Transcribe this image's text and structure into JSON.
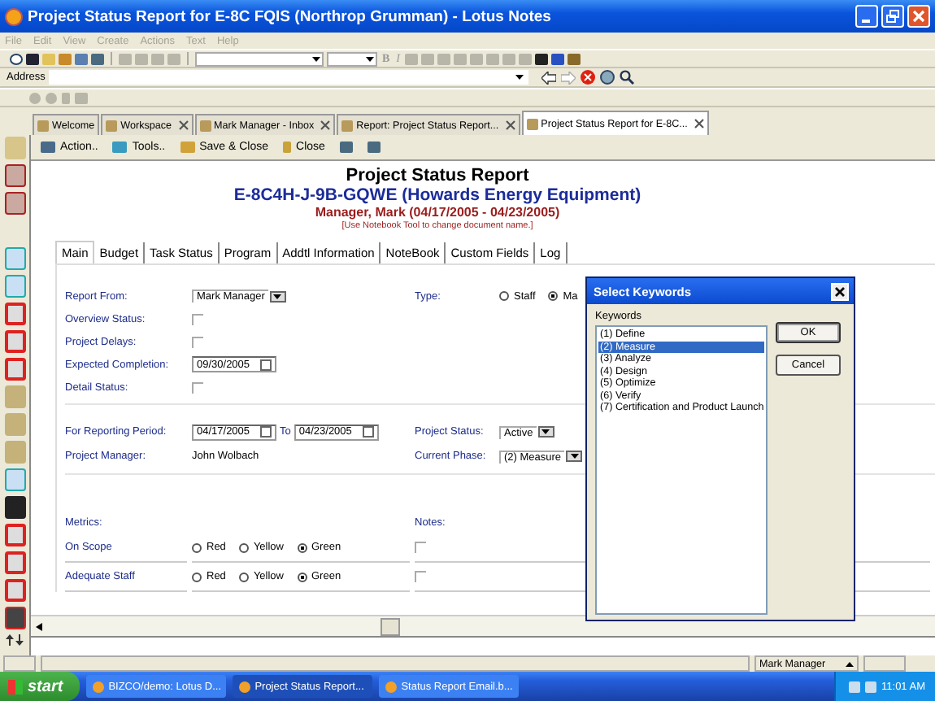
{
  "window": {
    "title": "Project Status Report for E-8C FQIS (Northrop Grumman) - Lotus Notes"
  },
  "menu": [
    {
      "label": "File",
      "disabled": true
    },
    {
      "label": "Edit",
      "disabled": true
    },
    {
      "label": "View",
      "disabled": true
    },
    {
      "label": "Create",
      "disabled": true
    },
    {
      "label": "Actions",
      "disabled": true
    },
    {
      "label": "Text",
      "disabled": true
    },
    {
      "label": "Help",
      "disabled": true
    }
  ],
  "toolbar": {
    "format_buttons": [
      "B",
      "I"
    ]
  },
  "address": {
    "label": "Address"
  },
  "tabs": [
    {
      "label": "Welcome",
      "selected": false,
      "closable": false
    },
    {
      "label": "Workspace",
      "selected": false,
      "closable": true
    },
    {
      "label": "Mark Manager - Inbox",
      "selected": false,
      "closable": true
    },
    {
      "label": "Report:  Project Status Report...",
      "selected": false,
      "closable": true
    },
    {
      "label": "Project Status Report for E-8C...",
      "selected": true,
      "closable": true
    }
  ],
  "actions": [
    "Action..",
    "Tools..",
    "Save & Close",
    "Close"
  ],
  "document": {
    "title": "Project Status Report",
    "subtitle": "E-8C4H-J-9B-GQWE (Howards Energy Equipment)",
    "manager_line": "Manager, Mark (04/17/2005 - 04/23/2005)",
    "hint": "[Use Notebook Tool to change document name.]",
    "tabs": [
      {
        "label": "Main",
        "selected": true
      },
      {
        "label": "Budget",
        "selected": false
      },
      {
        "label": "Task Status",
        "selected": false
      },
      {
        "label": "Program",
        "selected": false
      },
      {
        "label": "Addtl Information",
        "selected": false
      },
      {
        "label": "NoteBook",
        "selected": false
      },
      {
        "label": "Custom Fields",
        "selected": false
      },
      {
        "label": "Log",
        "selected": false
      }
    ]
  },
  "form": {
    "fields": [
      {
        "label": "Report From:",
        "kind": "keyword",
        "value": "Mark Manager"
      },
      {
        "label": "Overview Status:",
        "kind": "empty"
      },
      {
        "label": "Project Delays:",
        "kind": "empty"
      },
      {
        "label": "Expected Completion:",
        "kind": "date",
        "value": "09/30/2005"
      },
      {
        "label": "Detail Status:",
        "kind": "empty"
      }
    ],
    "type": {
      "label": "Type:",
      "options": [
        {
          "label": "Staff",
          "selected": false
        },
        {
          "label": "Ma",
          "selected": true
        }
      ]
    },
    "period": {
      "label": "For Reporting Period:",
      "from": "04/17/2005",
      "to_label": "To",
      "to": "04/23/2005"
    },
    "project_manager": {
      "label": "Project Manager:",
      "value": "John Wolbach"
    },
    "project_status": {
      "label": "Project Status:",
      "value": "Active"
    },
    "current_phase": {
      "label": "Current Phase:",
      "value": "(2)  Measure"
    }
  },
  "metrics": {
    "label": "Metrics:",
    "notes_label": "Notes:",
    "rows": [
      {
        "name": "On Scope",
        "options": [
          {
            "label": "Red",
            "selected": false
          },
          {
            "label": "Yellow",
            "selected": false
          },
          {
            "label": "Green",
            "selected": true
          }
        ]
      },
      {
        "name": "Adequate Staff",
        "options": [
          {
            "label": "Red",
            "selected": false
          },
          {
            "label": "Yellow",
            "selected": false
          },
          {
            "label": "Green",
            "selected": true
          }
        ]
      }
    ]
  },
  "dialog": {
    "title": "Select Keywords",
    "list_label": "Keywords",
    "items": [
      {
        "label": "(1)  Define",
        "selected": false
      },
      {
        "label": "(2)  Measure",
        "selected": true
      },
      {
        "label": "(3)  Analyze",
        "selected": false
      },
      {
        "label": "(4)  Design",
        "selected": false
      },
      {
        "label": "(5)  Optimize",
        "selected": false
      },
      {
        "label": "(6)  Verify",
        "selected": false
      },
      {
        "label": "(7)  Certification and Product Launch",
        "selected": false
      }
    ],
    "buttons": [
      "OK",
      "Cancel"
    ]
  },
  "status_bar": {
    "user": "Mark Manager"
  },
  "taskbar": {
    "start": "start",
    "tasks": [
      {
        "label": "BIZCO/demo: Lotus D...",
        "selected": false
      },
      {
        "label": "Project Status Report...",
        "selected": true
      },
      {
        "label": "Status Report Email.b...",
        "selected": false
      }
    ],
    "clock": "11:01 AM"
  }
}
